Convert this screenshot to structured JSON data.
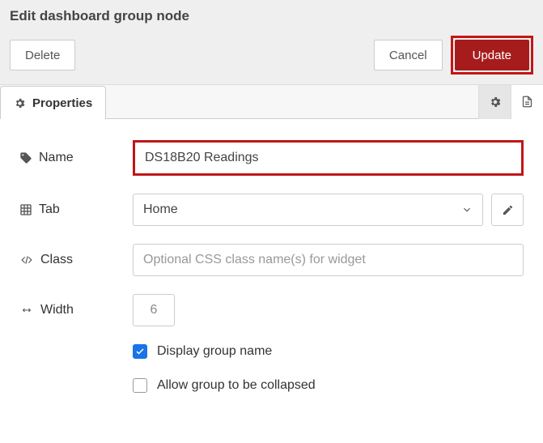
{
  "title": "Edit dashboard group node",
  "buttons": {
    "delete": "Delete",
    "cancel": "Cancel",
    "update": "Update"
  },
  "tabs": {
    "properties": "Properties"
  },
  "form": {
    "name_label": "Name",
    "name_value": "DS18B20 Readings",
    "tab_label": "Tab",
    "tab_value": "Home",
    "class_label": "Class",
    "class_placeholder": "Optional CSS class name(s) for widget",
    "class_value": "",
    "width_label": "Width",
    "width_value": "6",
    "cb_display": "Display group name",
    "cb_display_checked": true,
    "cb_collapse": "Allow group to be collapsed",
    "cb_collapse_checked": false
  }
}
